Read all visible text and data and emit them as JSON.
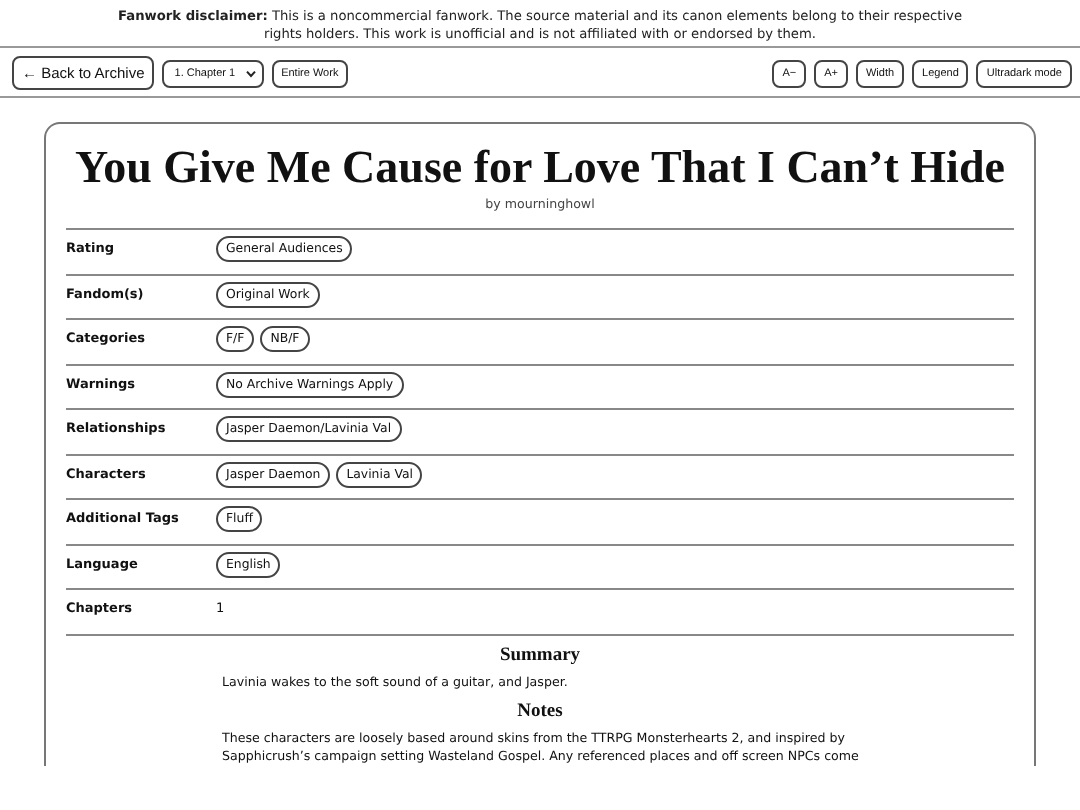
{
  "disclaimer": {
    "label": "Fanwork disclaimer:",
    "text": "This is a noncommercial fanwork. The source material and its canon elements belong to their respective rights holders. This work is unofficial and is not affiliated with or endorsed by them."
  },
  "toolbar": {
    "back": "← Back to Archive",
    "chapter_select": "1. Chapter 1",
    "entire_work": "Entire Work",
    "right_buttons": [
      "A−",
      "A+",
      "Width",
      "Legend",
      "Ultradark mode"
    ]
  },
  "work": {
    "title": "You Give Me Cause for Love That I Can’t Hide",
    "byline": "by mourninghowl",
    "meta": [
      {
        "label": "Rating",
        "tags": [
          "General Audiences"
        ]
      },
      {
        "label": "Fandom(s)",
        "tags": [
          "Original Work"
        ]
      },
      {
        "label": "Categories",
        "tags": [
          "F/F",
          "NB/F"
        ]
      },
      {
        "label": "Warnings",
        "tags": [
          "No Archive Warnings Apply"
        ]
      },
      {
        "label": "Relationships",
        "tags": [
          "Jasper Daemon/Lavinia Val"
        ]
      },
      {
        "label": "Characters",
        "tags": [
          "Jasper Daemon",
          "Lavinia Val"
        ]
      },
      {
        "label": "Additional Tags",
        "tags": [
          "Fluff"
        ]
      },
      {
        "label": "Language",
        "tags": [
          "English"
        ]
      },
      {
        "label": "Chapters",
        "value": "1"
      }
    ],
    "sections": [
      {
        "heading": "Summary",
        "text": "Lavinia wakes to the soft sound of a guitar, and Jasper."
      },
      {
        "heading": "Notes",
        "text": "These characters are loosely based around skins from the TTRPG Monsterhearts 2, and inspired by Sapphicrush’s campaign setting Wasteland Gospel. Any referenced places and off screen NPCs come"
      }
    ]
  }
}
